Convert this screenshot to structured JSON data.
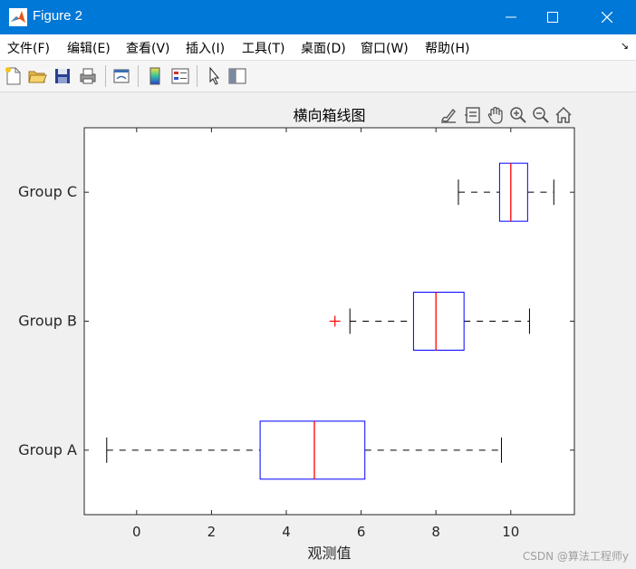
{
  "window": {
    "title": "Figure 2"
  },
  "menu": {
    "items": [
      "文件(F)",
      "编辑(E)",
      "查看(V)",
      "插入(I)",
      "工具(T)",
      "桌面(D)",
      "窗口(W)",
      "帮助(H)"
    ],
    "overflow_arrow": "↘"
  },
  "toolbar": {
    "icons": [
      "new-figure-icon",
      "open-file-icon",
      "save-icon",
      "print-icon",
      "link-plot-icon",
      "colorbar-icon",
      "legend-icon",
      "select-pointer-icon",
      "property-inspector-icon"
    ]
  },
  "axes_toolbar": {
    "icons": [
      "brush-icon",
      "datatip-icon",
      "pan-icon",
      "zoom-in-icon",
      "zoom-out-icon",
      "home-icon"
    ]
  },
  "watermark": "CSDN @算法工程师y",
  "chart_data": {
    "type": "boxplot",
    "orientation": "horizontal",
    "title": "横向箱线图",
    "xlabel": "观测值",
    "ylabel": "",
    "xlim": [
      -1.4,
      11.7
    ],
    "xticks": [
      0,
      2,
      4,
      6,
      8,
      10
    ],
    "grid": false,
    "colors": {
      "box": "#0000ff",
      "median": "#ff0000",
      "whisker": "#000000",
      "outlier": "#ff0000"
    },
    "groups": [
      {
        "name": "Group A",
        "whisker_low": -0.8,
        "q1": 3.3,
        "median": 4.75,
        "q3": 6.1,
        "whisker_high": 9.75,
        "outliers": []
      },
      {
        "name": "Group B",
        "whisker_low": 5.7,
        "q1": 7.4,
        "median": 8.0,
        "q3": 8.75,
        "whisker_high": 10.5,
        "outliers": [
          5.3
        ]
      },
      {
        "name": "Group C",
        "whisker_low": 8.6,
        "q1": 9.7,
        "median": 10.0,
        "q3": 10.45,
        "whisker_high": 11.15,
        "outliers": []
      }
    ]
  }
}
